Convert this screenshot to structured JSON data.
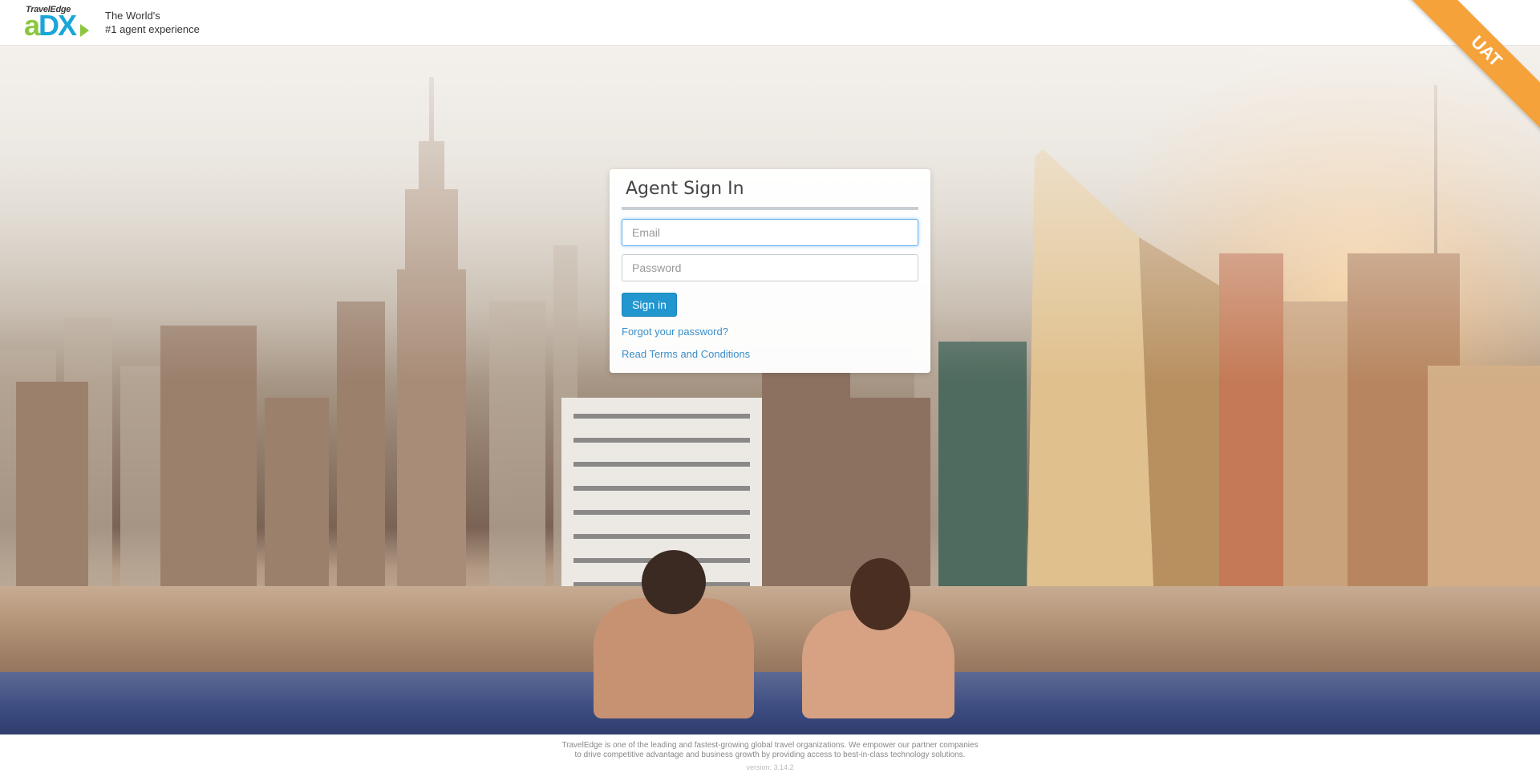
{
  "header": {
    "logo_small": "TravelEdge",
    "logo_big_a": "a",
    "logo_big_dx": "DX",
    "tagline_line1": "The World's",
    "tagline_line2": "#1 agent experience",
    "environment_badge": "UAT"
  },
  "signin": {
    "title": "Agent Sign In",
    "email_placeholder": "Email",
    "password_placeholder": "Password",
    "submit_label": "Sign in",
    "forgot_link": "Forgot your password?",
    "terms_link": "Read Terms and Conditions"
  },
  "footer": {
    "line1": "TravelEdge is one of the leading and fastest-growing global travel organizations. We empower our partner companies",
    "line2": "to drive competitive advantage and business growth by providing access to best-in-class technology solutions.",
    "version": "version: 3.14.2"
  },
  "colors": {
    "primary_button": "#2196cf",
    "link": "#3a8fc8",
    "badge": "#f5a23a",
    "logo_green": "#8cc63f",
    "logo_blue": "#1aa6d8"
  }
}
